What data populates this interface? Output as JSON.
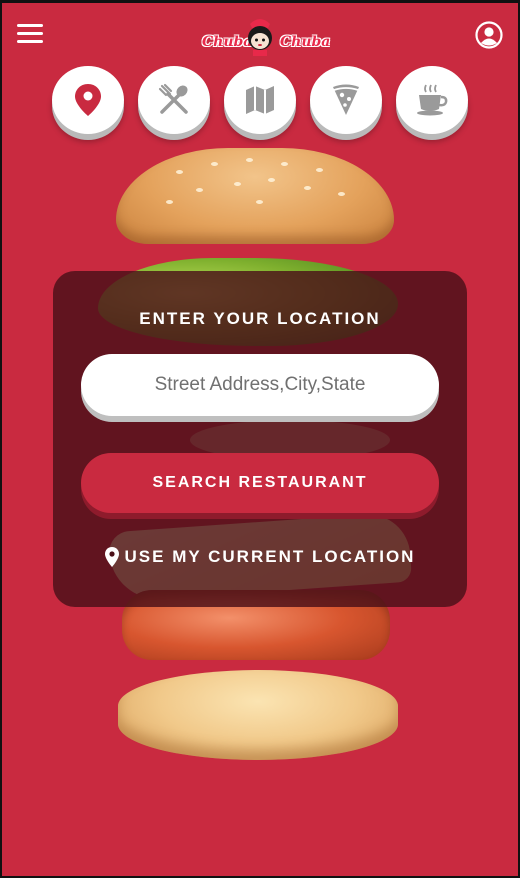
{
  "header": {
    "menu_icon": "hamburger-menu-icon",
    "logo_text_left": "Chuba",
    "logo_text_right": "Chuba",
    "profile_icon": "user-profile-icon"
  },
  "categories": [
    {
      "icon": "location-pin-icon",
      "active": true
    },
    {
      "icon": "fork-knife-icon"
    },
    {
      "icon": "map-icon"
    },
    {
      "icon": "pizza-slice-icon"
    },
    {
      "icon": "coffee-cup-icon"
    }
  ],
  "search_card": {
    "title": "ENTER YOUR LOCATION",
    "address_placeholder": "Street Address,City,State",
    "search_button_label": "SEARCH RESTAURANT",
    "current_location_label": "USE MY CURRENT LOCATION"
  },
  "colors": {
    "background": "#c92a40",
    "accent": "#c92a40",
    "card": "#4b1018"
  }
}
